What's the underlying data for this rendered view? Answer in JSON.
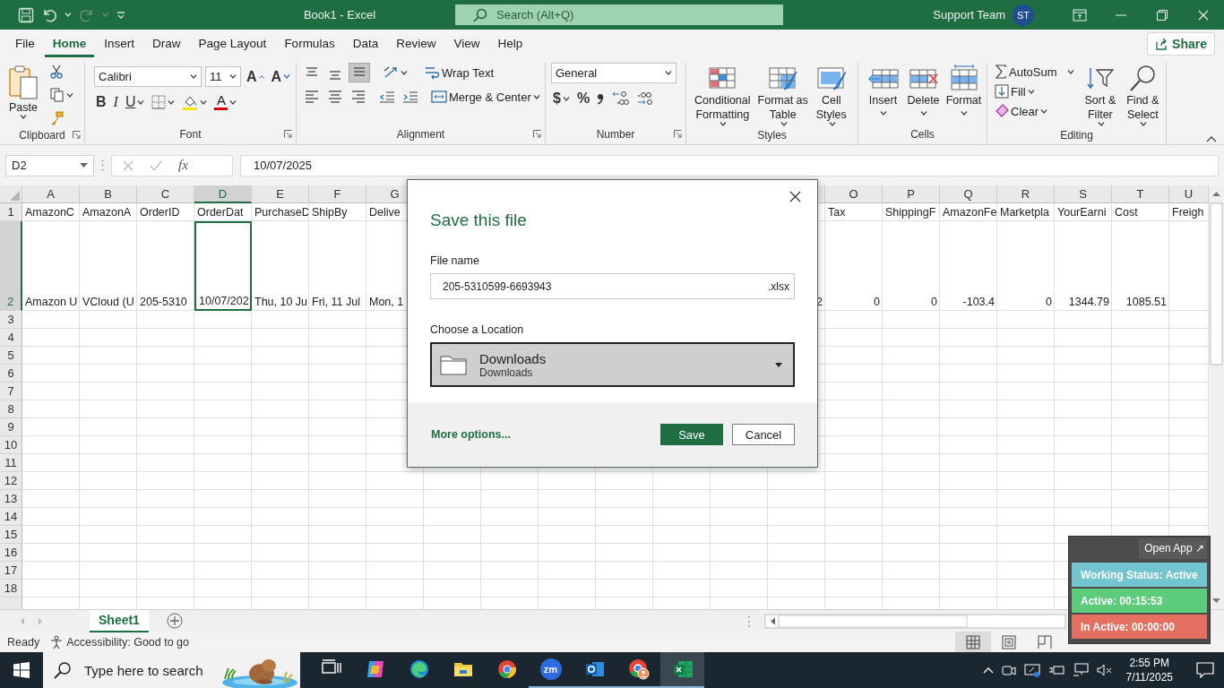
{
  "window": {
    "title": "Book1  -  Excel",
    "search_placeholder": "Search (Alt+Q)",
    "user_name": "Support Team",
    "user_initials": "ST"
  },
  "menu_tabs": [
    {
      "label": "File",
      "selected": false
    },
    {
      "label": "Home",
      "selected": true
    },
    {
      "label": "Insert",
      "selected": false
    },
    {
      "label": "Draw",
      "selected": false
    },
    {
      "label": "Page Layout",
      "selected": false
    },
    {
      "label": "Formulas",
      "selected": false
    },
    {
      "label": "Data",
      "selected": false
    },
    {
      "label": "Review",
      "selected": false
    },
    {
      "label": "View",
      "selected": false
    },
    {
      "label": "Help",
      "selected": false
    }
  ],
  "share_button": "Share",
  "ribbon": {
    "clipboard": {
      "title": "Clipboard",
      "paste": "Paste"
    },
    "font": {
      "title": "Font",
      "font_name": "Calibri",
      "font_size": "11",
      "grow": "A",
      "shrink": "A",
      "bold": "B",
      "italic": "I",
      "underline": "U",
      "font_color": "A"
    },
    "alignment": {
      "title": "Alignment",
      "vertical": [
        {
          "selected": false
        },
        {
          "selected": false
        },
        {
          "selected": true
        }
      ],
      "wrap_text": "Wrap Text",
      "merge": "Merge & Center"
    },
    "number": {
      "title": "Number",
      "format": "General",
      "currency": "$",
      "percent": "%"
    },
    "styles": {
      "title": "Styles",
      "buttons": [
        {
          "label": "Conditional\nFormatting",
          "kind": "conditional"
        },
        {
          "label": "Format as\nTable",
          "kind": "table"
        },
        {
          "label": "Cell\nStyles",
          "kind": "cellstyle"
        }
      ]
    },
    "cells": {
      "title": "Cells",
      "buttons": [
        {
          "label": "Insert",
          "kind": "insert"
        },
        {
          "label": "Delete",
          "kind": "delete"
        },
        {
          "label": "Format",
          "kind": "format"
        }
      ]
    },
    "editing": {
      "title": "Editing",
      "autosum": "AutoSum",
      "fill": "Fill",
      "clear": "Clear",
      "sort": "Sort &\nFilter",
      "find": "Find &\nSelect"
    }
  },
  "formula_bar": {
    "name_box": "D2",
    "fx": "fx",
    "value": "10/07/2025"
  },
  "sheet": {
    "columns": [
      {
        "letter": "A",
        "selected": false
      },
      {
        "letter": "B",
        "selected": false
      },
      {
        "letter": "C",
        "selected": false
      },
      {
        "letter": "D",
        "selected": true
      },
      {
        "letter": "E",
        "selected": false
      },
      {
        "letter": "F",
        "selected": false
      },
      {
        "letter": "G",
        "selected": false
      },
      null,
      null,
      null,
      null,
      null,
      null,
      null,
      {
        "letter": "O",
        "selected": false
      },
      {
        "letter": "P",
        "selected": false
      },
      {
        "letter": "Q",
        "selected": false
      },
      {
        "letter": "R",
        "selected": false
      },
      {
        "letter": "S",
        "selected": false
      },
      {
        "letter": "T",
        "selected": false
      },
      {
        "letter": "U",
        "selected": false
      }
    ],
    "rows": [
      {
        "number": "1",
        "selected": false,
        "tall": false,
        "cells": [
          {
            "text": "AmazonC",
            "kind": "text"
          },
          {
            "text": "AmazonA",
            "kind": "text"
          },
          {
            "text": "OrderID",
            "kind": "text"
          },
          {
            "text": "OrderDat",
            "kind": "text"
          },
          {
            "text": "PurchaseD",
            "kind": "text"
          },
          {
            "text": "ShipBy",
            "kind": "text"
          },
          {
            "text": "Delive",
            "kind": "text"
          },
          null,
          null,
          null,
          null,
          null,
          null,
          null,
          {
            "text": "Tax",
            "kind": "text"
          },
          {
            "text": "ShippingF",
            "kind": "text"
          },
          {
            "text": "AmazonFe",
            "kind": "text"
          },
          {
            "text": "Marketpla",
            "kind": "text"
          },
          {
            "text": "YourEarni",
            "kind": "text"
          },
          {
            "text": "Cost",
            "kind": "text"
          },
          {
            "text": "Freigh",
            "kind": "text"
          }
        ]
      },
      {
        "number": "2",
        "selected": true,
        "tall": true,
        "cells": [
          {
            "text": "Amazon U",
            "kind": "text"
          },
          {
            "text": "VCloud (U",
            "kind": "text"
          },
          {
            "text": "205-5310",
            "kind": "text"
          },
          {
            "text": "10/07/202",
            "kind": "text"
          },
          {
            "text": "Thu, 10 Ju",
            "kind": "text"
          },
          {
            "text": "Fri, 11 Jul",
            "kind": "text"
          },
          {
            "text": "Mon, 1",
            "kind": "text"
          },
          null,
          null,
          null,
          null,
          null,
          null,
          {
            "text": "2",
            "kind": "number"
          },
          {
            "text": "0",
            "kind": "number"
          },
          {
            "text": "0",
            "kind": "number"
          },
          {
            "text": "-103.4",
            "kind": "number"
          },
          {
            "text": "0",
            "kind": "number"
          },
          {
            "text": "1344.79",
            "kind": "number"
          },
          {
            "text": "1085.51",
            "kind": "number"
          },
          null
        ]
      },
      {
        "number": "3",
        "selected": false,
        "tall": false
      },
      {
        "number": "4",
        "selected": false,
        "tall": false
      },
      {
        "number": "5",
        "selected": false,
        "tall": false
      },
      {
        "number": "6",
        "selected": false,
        "tall": false
      },
      {
        "number": "7",
        "selected": false,
        "tall": false
      },
      {
        "number": "8",
        "selected": false,
        "tall": false
      },
      {
        "number": "9",
        "selected": false,
        "tall": false
      },
      {
        "number": "10",
        "selected": false,
        "tall": false
      },
      {
        "number": "11",
        "selected": false,
        "tall": false
      },
      {
        "number": "12",
        "selected": false,
        "tall": false
      },
      {
        "number": "13",
        "selected": false,
        "tall": false
      },
      {
        "number": "14",
        "selected": false,
        "tall": false
      },
      {
        "number": "15",
        "selected": false,
        "tall": false
      },
      {
        "number": "16",
        "selected": false,
        "tall": false
      },
      {
        "number": "17",
        "selected": false,
        "tall": false
      },
      {
        "number": "18",
        "selected": false,
        "tall": false
      }
    ]
  },
  "dialog": {
    "title": "Save this file",
    "file_name_label": "File name",
    "file_name": "205-5310599-6693943",
    "extension": ".xlsx",
    "location_label": "Choose a Location",
    "location": {
      "name": "Downloads",
      "path": "Downloads"
    },
    "more_options": "More options...",
    "buttons": [
      {
        "label": "Save",
        "kind": "primary"
      },
      {
        "label": "Cancel",
        "kind": "secondary"
      }
    ]
  },
  "sheet_tabs": [
    {
      "label": "Sheet1",
      "selected": true
    }
  ],
  "status_bar": {
    "state": "Ready",
    "accessibility": "Accessibility: Good to go",
    "views": [
      {
        "kind": "normal",
        "selected": true
      },
      {
        "kind": "page_layout",
        "selected": false
      },
      {
        "kind": "page_break",
        "selected": false
      }
    ]
  },
  "tracker": {
    "open_app": "Open App ↗",
    "statuses": [
      {
        "text": "Working Status: Active",
        "color": "#72c5cf"
      },
      {
        "text": "Active: 00:15:53",
        "color": "#5ccb7c"
      },
      {
        "text": "In Active: 00:00:00",
        "color": "#e56f60"
      }
    ]
  },
  "taskbar": {
    "search_placeholder": "Type here to search",
    "apps": [
      {
        "kind": "task_view",
        "running": false,
        "selected": false
      },
      {
        "kind": "copilot",
        "running": false,
        "selected": false
      },
      {
        "kind": "edge",
        "running": false,
        "selected": false
      },
      {
        "kind": "explorer",
        "running": false,
        "selected": false
      },
      {
        "kind": "chrome",
        "running": false,
        "selected": false
      },
      {
        "kind": "zoom",
        "label": "zm",
        "running": true,
        "selected": false
      },
      {
        "kind": "outlook",
        "running": true,
        "selected": false
      },
      {
        "kind": "chrome_profile",
        "running": true,
        "selected": false
      },
      {
        "kind": "excel",
        "running": true,
        "selected": true
      }
    ],
    "time": "2:55 PM",
    "date": "7/11/2025"
  }
}
